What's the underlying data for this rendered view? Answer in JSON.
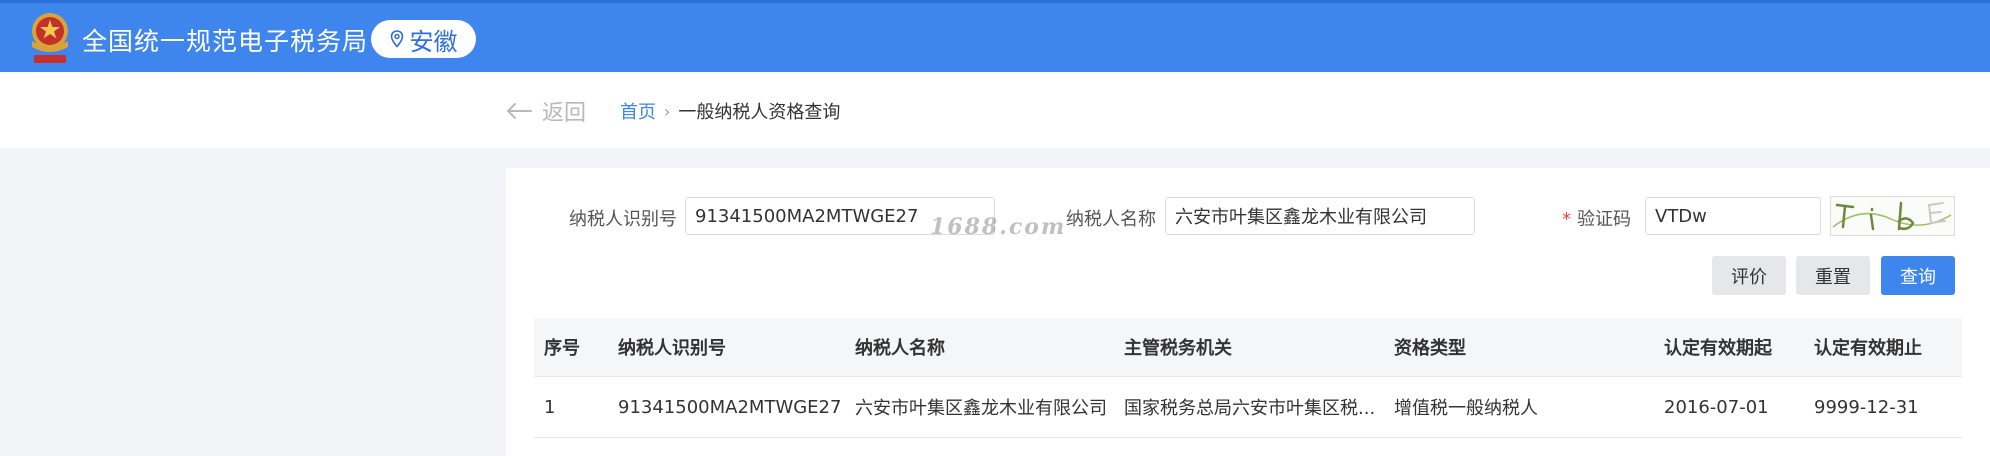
{
  "header": {
    "site_title": "全国统一规范电子税务局",
    "region": "安徽",
    "colors": {
      "bar": "#3f85ee",
      "pill_text": "#2f6fd9"
    }
  },
  "breadcrumb": {
    "back_label": "返回",
    "home": "首页",
    "separator": "›",
    "current": "一般纳税人资格查询"
  },
  "form": {
    "taxpayer_id_label": "纳税人识别号",
    "taxpayer_id_value": "91341500MA2MTWGE27",
    "taxpayer_name_label": "纳税人名称",
    "taxpayer_name_value": "六安市叶集区鑫龙木业有限公司",
    "captcha_required_mark": "*",
    "captcha_label": "验证码",
    "captcha_value": "VTDw",
    "watermark": "1688.com"
  },
  "buttons": {
    "evaluate": "评价",
    "reset": "重置",
    "query": "查询"
  },
  "table": {
    "headers": [
      "序号",
      "纳税人识别号",
      "纳税人名称",
      "主管税务机关",
      "资格类型",
      "认定有效期起",
      "认定有效期止"
    ],
    "rows": [
      [
        "1",
        "91341500MA2MTWGE27",
        "六安市叶集区鑫龙木业有限公司",
        "国家税务总局六安市叶集区税...",
        "增值税一般纳税人",
        "2016-07-01",
        "9999-12-31"
      ]
    ]
  },
  "icons": {
    "emblem": "tax-emblem-icon",
    "region": "location-pin-icon",
    "back": "arrow-left-icon",
    "captcha": "captcha-image"
  }
}
